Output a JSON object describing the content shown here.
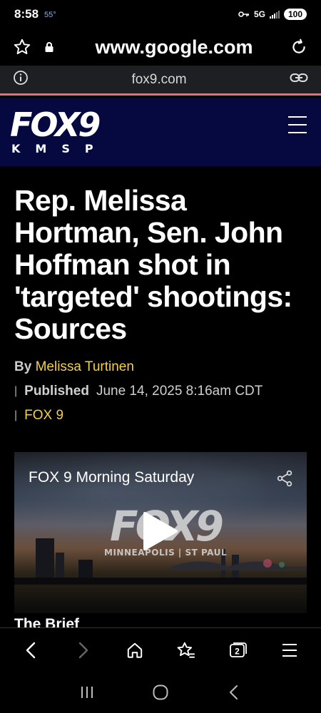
{
  "status_bar": {
    "time": "8:58",
    "temperature": "55°",
    "network": "5G",
    "battery": "100"
  },
  "browser": {
    "url": "www.google.com",
    "site": "fox9.com"
  },
  "site_header": {
    "logo_word": "FOX9",
    "logo_callsign": "KMSP"
  },
  "article": {
    "headline": "Rep. Melissa Hortman, Sen. John Hoffman shot in 'targeted' shootings: Sources",
    "by_prefix": "By",
    "author": "Melissa Turtinen",
    "published_label": "Published",
    "published_date": "June 14, 2025 8:16am CDT",
    "source": "FOX 9"
  },
  "video": {
    "title": "FOX 9 Morning Saturday",
    "logo_word": "FOX9",
    "logo_city": "MINNEAPOLIS | ST PAUL"
  },
  "section": {
    "brief_title": "The Brief"
  },
  "icons": {
    "bookmark": "star-icon",
    "lock": "lock-icon",
    "reload": "reload-icon",
    "info": "info-icon",
    "link": "link-icon",
    "menu": "hamburger-menu-icon",
    "share": "share-icon",
    "play": "play-icon",
    "back": "back-arrow-icon",
    "forward": "forward-arrow-icon",
    "home": "home-icon",
    "bookmarks": "bookmarks-icon",
    "tabs": "tabs-icon",
    "more": "more-menu-icon",
    "recents": "recents-icon",
    "system_home": "system-home-icon",
    "system_back": "system-back-icon"
  },
  "toolbar": {
    "tab_count": "2"
  },
  "colors": {
    "fox_blue": "#05093f",
    "author_yellow": "#f2d04b",
    "strip_accent": "#e8707d"
  }
}
